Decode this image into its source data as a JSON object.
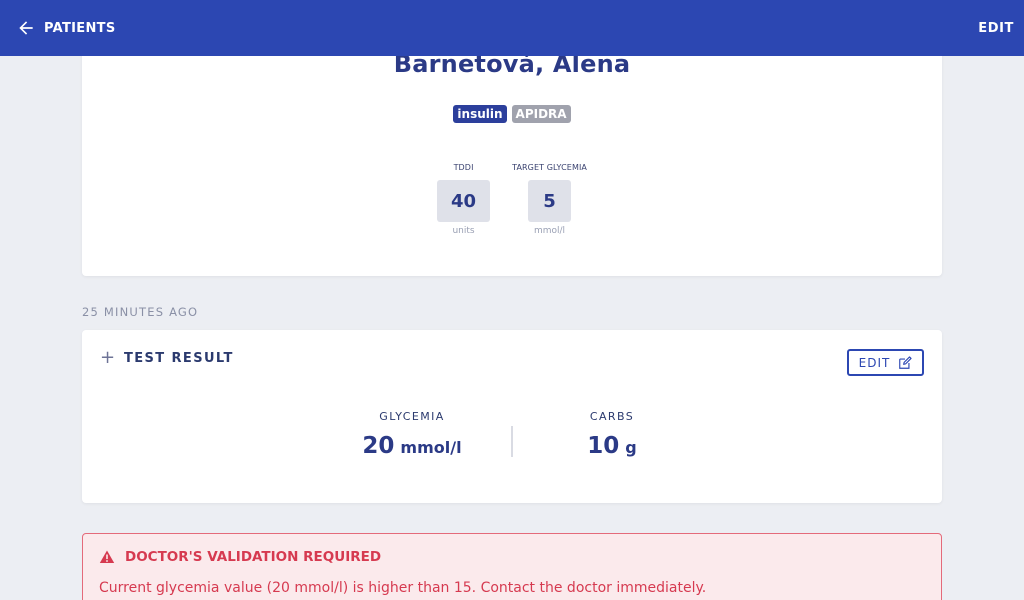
{
  "header": {
    "back_label": "PATIENTS",
    "edit_label": "EDIT",
    "bg_color": "#2c47b2"
  },
  "patient": {
    "name": "Barnetová, Alena",
    "badges": [
      "insulin",
      "APIDRA"
    ],
    "stats": [
      {
        "label": "TDDI",
        "value": "40",
        "unit": "units"
      },
      {
        "label": "TARGET GLYCEMIA",
        "value": "5",
        "unit": "mmol/l"
      }
    ]
  },
  "result": {
    "timestamp": "25 MINUTES AGO",
    "title": "TEST RESULT",
    "edit_label": "EDIT",
    "glycemia": {
      "label": "GLYCEMIA",
      "value": "20",
      "unit": "mmol/l"
    },
    "carbs": {
      "label": "CARBS",
      "value": "10",
      "unit": "g"
    }
  },
  "alert": {
    "title": "DOCTOR'S VALIDATION REQUIRED",
    "message": "Current glycemia value (20 mmol/l) is higher than 15. Contact the doctor immediately.",
    "color": "#d63a50"
  },
  "icons": {
    "back": "arrow-left-icon",
    "plus": "plus-icon",
    "edit": "edit-icon",
    "warning": "warning-icon"
  }
}
